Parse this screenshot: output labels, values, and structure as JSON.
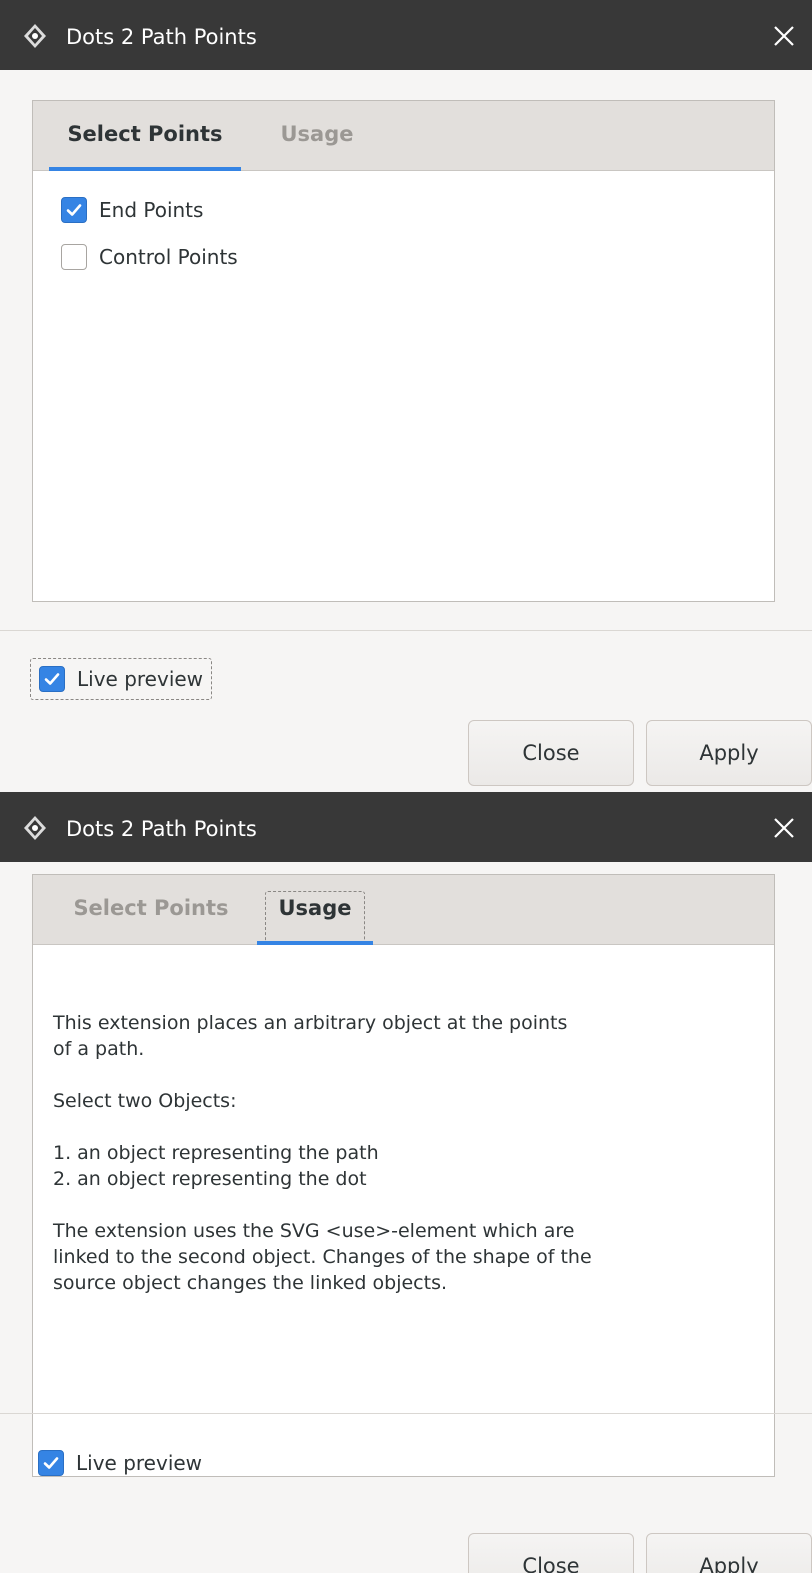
{
  "window_top": {
    "title": "Dots 2 Path Points",
    "tabs": [
      {
        "label": "Select Points",
        "active": true
      },
      {
        "label": "Usage",
        "active": false
      }
    ],
    "options": [
      {
        "label": "End Points",
        "checked": true
      },
      {
        "label": "Control Points",
        "checked": false
      }
    ],
    "live_preview": {
      "label": "Live preview",
      "checked": true
    },
    "buttons": {
      "close": "Close",
      "apply": "Apply"
    }
  },
  "window_bottom": {
    "title": "Dots 2 Path Points",
    "tabs": [
      {
        "label": "Select Points",
        "active": false
      },
      {
        "label": "Usage",
        "active": true
      }
    ],
    "usage_paragraphs": [
      [
        "This extension places an arbitrary object at the points",
        "of a path."
      ],
      [
        "Select two Objects:"
      ],
      [
        "1. an object representing the path",
        "2. an object representing the dot"
      ],
      [
        "The extension uses the SVG <use>-element which are",
        "linked to the second object. Changes of the shape of the",
        "source object changes the linked objects."
      ]
    ],
    "live_preview": {
      "label": "Live preview",
      "checked": true
    },
    "buttons": {
      "close_mnemonic": "C",
      "close_rest": "lose",
      "apply_mnemonic": "A",
      "apply_rest": "pply"
    }
  },
  "colors": {
    "titlebar": "#383838",
    "accent": "#3584e4",
    "window_bg": "#f6f5f4",
    "tab_strip": "#e2dfdc"
  },
  "icons": [
    "inkscape-app-icon",
    "close-icon",
    "checkmark-icon"
  ]
}
